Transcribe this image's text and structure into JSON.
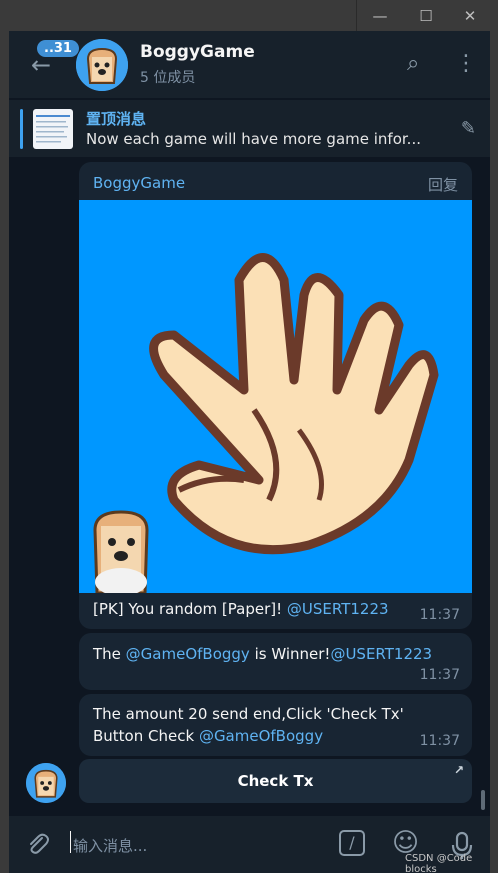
{
  "window": {
    "minimize_glyph": "—",
    "maximize_glyph": "☐",
    "close_glyph": "✕"
  },
  "header": {
    "back_glyph": "←",
    "unread_badge": "..31",
    "title": "BoggyGame",
    "subtitle": "5 位成员",
    "search_glyph": "⌕",
    "menu_glyph": "⋮"
  },
  "pinned": {
    "title": "置顶消息",
    "text": "Now each game will have more game infor...",
    "icon_glyph": "✎"
  },
  "messages": [
    {
      "sender": "BoggyGame",
      "reply_label": "回复",
      "text_prefix": "[PK] You random [Paper]! ",
      "mention": "@USERT1223",
      "time": "11:37"
    },
    {
      "text_prefix": "The ",
      "mention1": "@GameOfBoggy",
      "text_mid": " is Winner!",
      "mention2": "@USERT1223",
      "time": "11:37"
    },
    {
      "line1": "The amount 20 send end,Click 'Check Tx'",
      "line2_prefix": "Button Check ",
      "mention": "@GameOfBoggy",
      "time": "11:37"
    }
  ],
  "inline_button": {
    "label": "Check Tx",
    "arrow_glyph": "↗"
  },
  "composer": {
    "placeholder": "输入消息...",
    "attach_glyph": "⊘",
    "commands_glyph": "/",
    "emoji_glyph": "☺",
    "mic_glyph": "🎙"
  },
  "watermark": "CSDN @Code blocks",
  "colors": {
    "accent": "#5fb3f2",
    "bubble": "#182533",
    "background": "#0e1621",
    "sticker_bg": "#0097ff"
  }
}
